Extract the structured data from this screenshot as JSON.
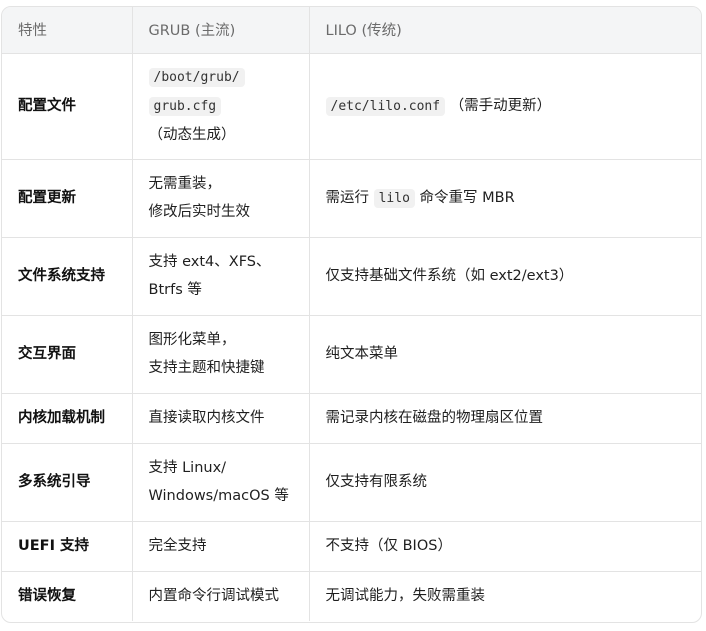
{
  "headers": [
    "特性",
    "GRUB (主流)",
    "LILO (传统)"
  ],
  "rows": [
    {
      "feature": "配置文件",
      "grub": {
        "code1": "/boot/grub/",
        "code2": "grub.cfg",
        "text": "（动态生成）"
      },
      "lilo": {
        "code": "/etc/lilo.conf",
        "text": "（需手动更新）"
      }
    },
    {
      "feature": "配置更新",
      "grub": {
        "line1": "无需重装，",
        "line2": "修改后实时生效"
      },
      "lilo": {
        "pre": "需运行",
        "code": "lilo",
        "post": "命令重写 MBR"
      }
    },
    {
      "feature": "文件系统支持",
      "grub": {
        "line1": "支持 ext4、XFS、",
        "line2": "Btrfs 等"
      },
      "lilo": {
        "text": "仅支持基础文件系统（如 ext2/ext3）"
      }
    },
    {
      "feature": "交互界面",
      "grub": {
        "line1": "图形化菜单，",
        "line2": "支持主题和快捷键"
      },
      "lilo": {
        "text": "纯文本菜单"
      }
    },
    {
      "feature": "内核加载机制",
      "grub": {
        "text": "直接读取内核文件"
      },
      "lilo": {
        "text": "需记录内核在磁盘的物理扇区位置"
      }
    },
    {
      "feature": "多系统引导",
      "grub": {
        "line1": "支持 Linux/",
        "line2": "Windows/macOS 等"
      },
      "lilo": {
        "text": "仅支持有限系统"
      }
    },
    {
      "feature": "UEFI 支持",
      "grub": {
        "text": "完全支持"
      },
      "lilo": {
        "text": "不支持（仅 BIOS）"
      }
    },
    {
      "feature": "错误恢复",
      "grub": {
        "text": "内置命令行调试模式"
      },
      "lilo": {
        "text": "无调试能力，失败需重装"
      }
    }
  ]
}
